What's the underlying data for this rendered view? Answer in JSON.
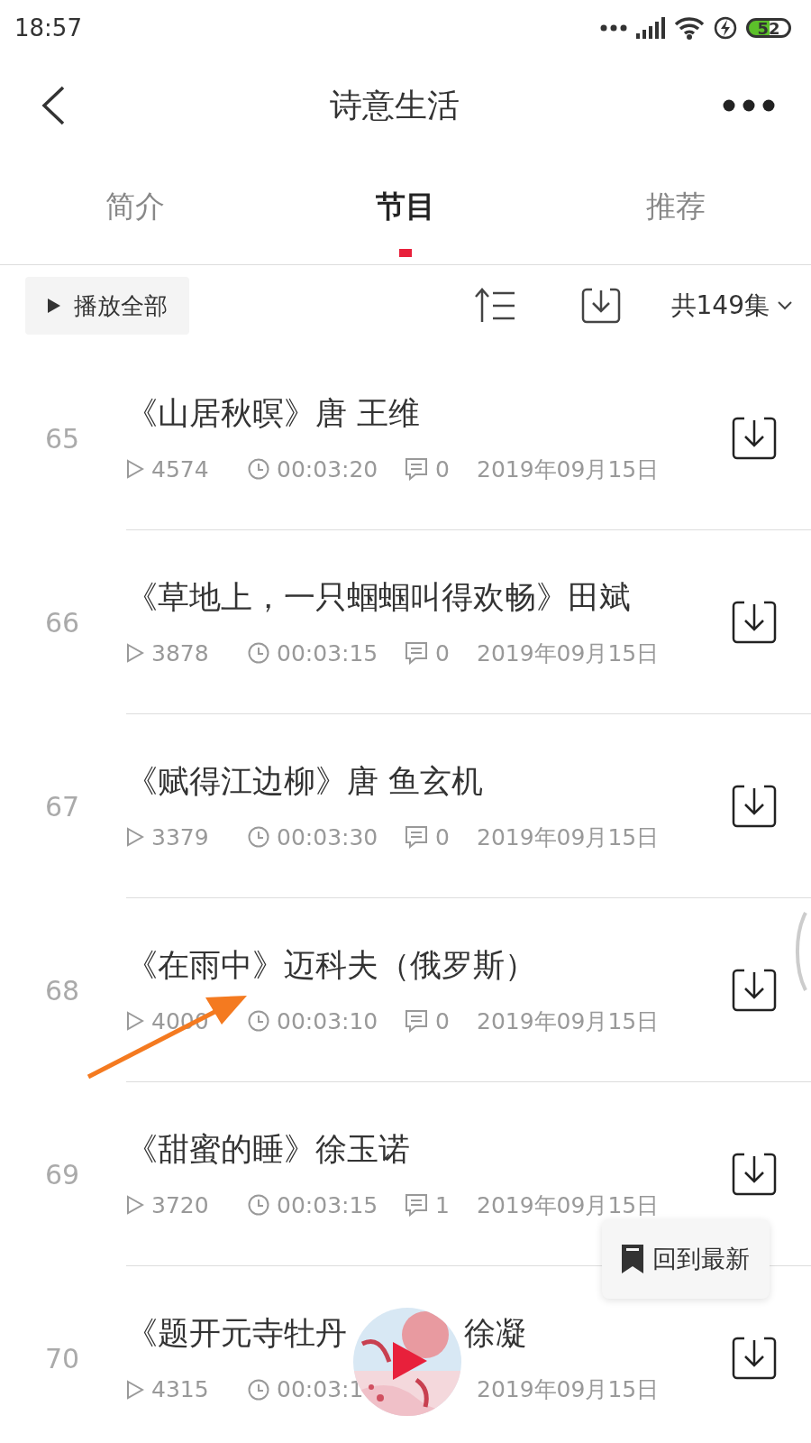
{
  "status_bar": {
    "time": "18:57",
    "battery": "52"
  },
  "header": {
    "title": "诗意生活"
  },
  "tabs": [
    {
      "label": "简介",
      "selected": false
    },
    {
      "label": "节目",
      "selected": true
    },
    {
      "label": "推荐",
      "selected": false
    }
  ],
  "toolbar": {
    "play_all": "播放全部",
    "count": "共149集"
  },
  "episodes": [
    {
      "number": "65",
      "title": "《山居秋暝》唐 王维",
      "plays": "4574",
      "duration": "00:03:20",
      "comments": "0",
      "date": "2019年09月15日"
    },
    {
      "number": "66",
      "title": "《草地上，一只蝈蝈叫得欢畅》田斌",
      "plays": "3878",
      "duration": "00:03:15",
      "comments": "0",
      "date": "2019年09月15日"
    },
    {
      "number": "67",
      "title": "《赋得江边柳》唐 鱼玄机",
      "plays": "3379",
      "duration": "00:03:30",
      "comments": "0",
      "date": "2019年09月15日"
    },
    {
      "number": "68",
      "title": "《在雨中》迈科夫（俄罗斯）",
      "plays": "4000",
      "duration": "00:03:10",
      "comments": "0",
      "date": "2019年09月15日"
    },
    {
      "number": "69",
      "title": "《甜蜜的睡》徐玉诺",
      "plays": "3720",
      "duration": "00:03:15",
      "comments": "1",
      "date": "2019年09月15日"
    },
    {
      "number": "70",
      "title": "《题开元寺牡丹",
      "title_tail": "徐凝",
      "plays": "4315",
      "duration": "00:03:1",
      "date": "2019年09月15日"
    }
  ],
  "back_to_latest": {
    "label": "回到最新"
  }
}
